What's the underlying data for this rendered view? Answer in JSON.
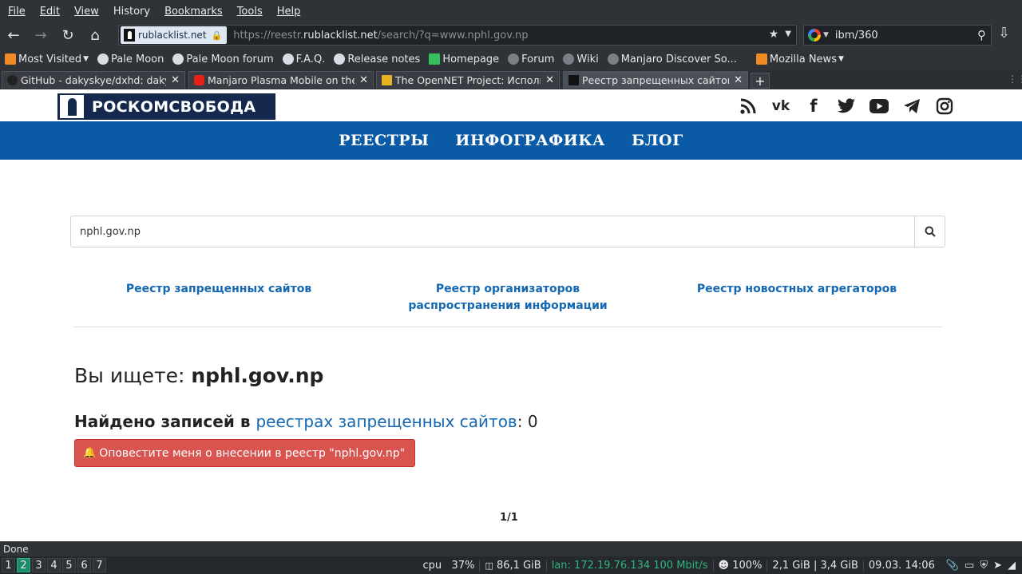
{
  "menubar": [
    "File",
    "Edit",
    "View",
    "History",
    "Bookmarks",
    "Tools",
    "Help"
  ],
  "urlbar": {
    "site_label": "rublacklist.net",
    "url_prefix": "https://reestr.",
    "url_domain": "rublacklist.net",
    "url_path": "/search/?q=www.nphl.gov.np"
  },
  "searchbar": {
    "value": "ibm/360"
  },
  "bookmarks": [
    {
      "label": "Most Visited",
      "icon": "rss",
      "dropdown": true
    },
    {
      "label": "Pale Moon",
      "icon": "moon"
    },
    {
      "label": "Pale Moon forum",
      "icon": "moon"
    },
    {
      "label": "F.A.Q.",
      "icon": "moon"
    },
    {
      "label": "Release notes",
      "icon": "moon"
    },
    {
      "label": "Homepage",
      "icon": "manjaro"
    },
    {
      "label": "Forum",
      "icon": "globe"
    },
    {
      "label": "Wiki",
      "icon": "globe"
    },
    {
      "label": "Manjaro Discover So...",
      "icon": "globe"
    },
    {
      "label": "Mozilla News",
      "icon": "rss",
      "dropdown": true
    }
  ],
  "tabs": [
    {
      "title": "GitHub - dakyskye/dxhd: daky'...",
      "icon": "github"
    },
    {
      "title": "Manjaro Plasma Mobile on the ...",
      "icon": "youtube"
    },
    {
      "title": "The OpenNET Project: Исполь...",
      "icon": "star"
    },
    {
      "title": "Реестр запрещенных сайтов",
      "icon": "rk",
      "active": true
    }
  ],
  "site": {
    "logo_text": "РОСКОМСВОБОДА",
    "social": [
      "rss-icon",
      "vk-icon",
      "facebook-icon",
      "twitter-icon",
      "youtube-icon",
      "telegram-icon",
      "instagram-icon"
    ],
    "nav": [
      "РЕЕСТРЫ",
      "ИНФОГРАФИКА",
      "БЛОГ"
    ],
    "search_value": "nphl.gov.np",
    "registry_links": [
      "Реестр запрещенных сайтов",
      "Реестр организаторов распространения информации",
      "Реестр новостных агрегаторов"
    ],
    "heading_prefix": "Вы ищете: ",
    "heading_query": "nphl.gov.np",
    "found_prefix": "Найдено записей в ",
    "found_link": "реестрах запрещенных сайтов",
    "found_suffix": ": 0",
    "notify_button": "Оповестите меня о внесении в реестр \"nphl.gov.np\"",
    "pager": "1/1"
  },
  "status": "Done",
  "taskbar": {
    "workspaces": [
      "1",
      "2",
      "3",
      "4",
      "5",
      "6",
      "7"
    ],
    "active_workspace": 1,
    "cpu": "cpu   37%",
    "disk": "86,1 GiB",
    "lan": "lan: 172.19.76.134 100 Mbit/s",
    "volume": "100%",
    "memory": "2,1 GiB | 3,4 GiB",
    "clock": "09.03. 14:06"
  }
}
